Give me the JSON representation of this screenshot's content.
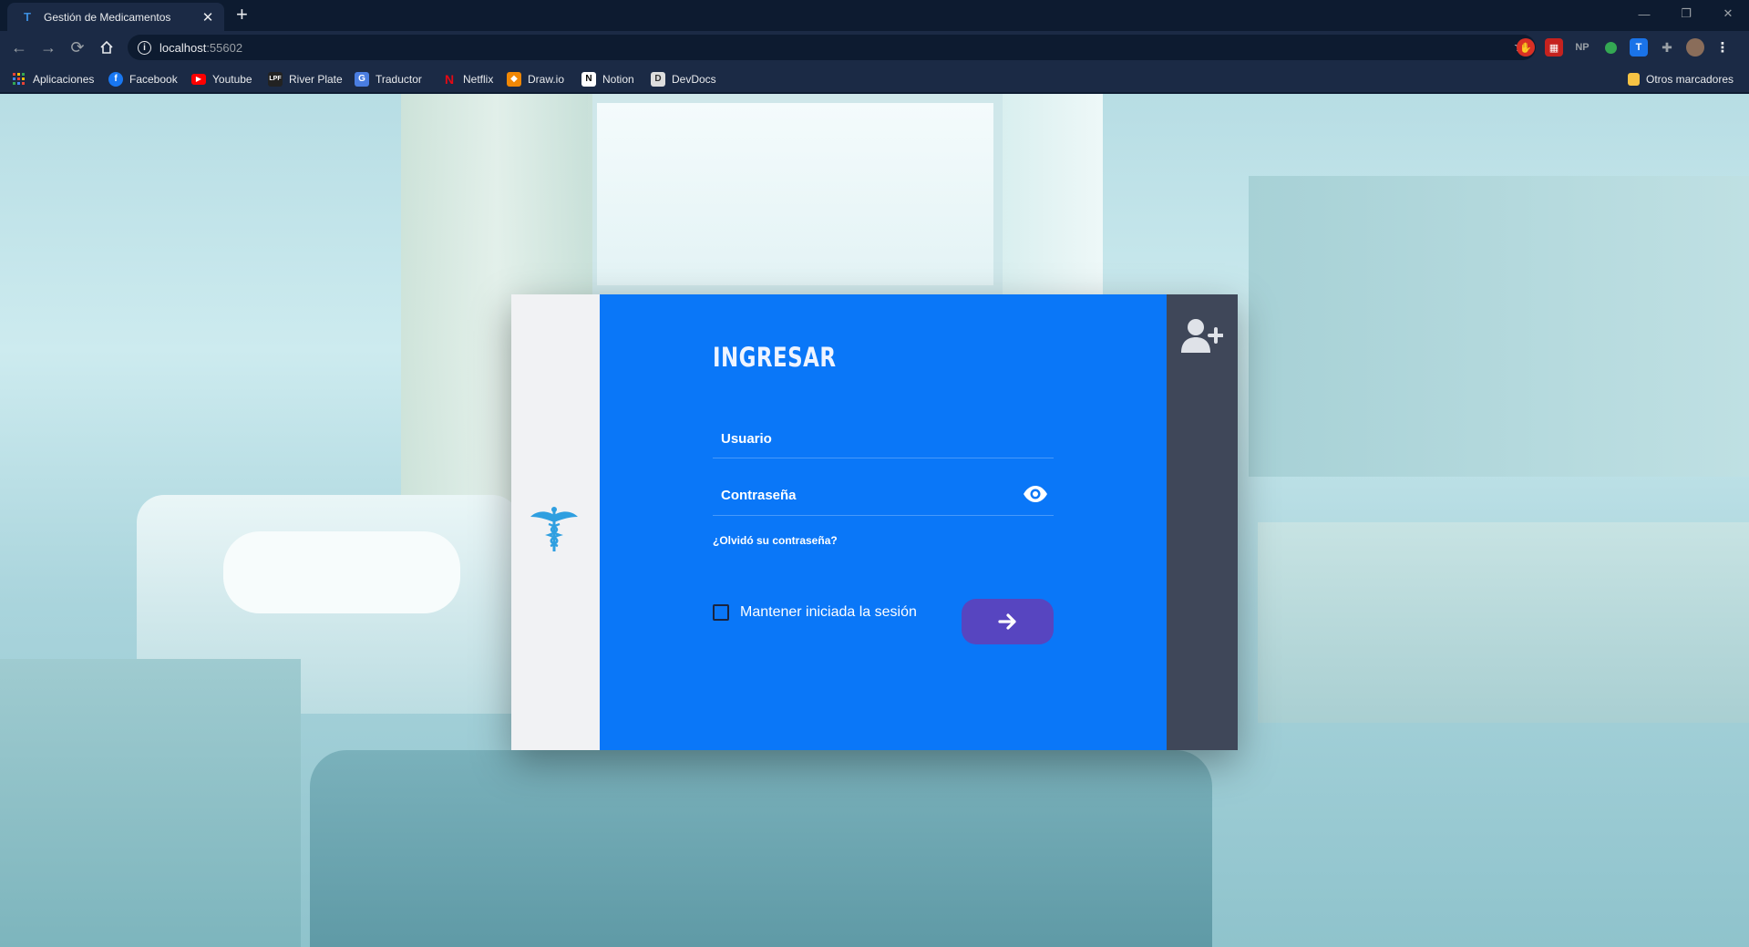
{
  "browser": {
    "tab_title": "Gestión de Medicamentos",
    "url_host": "localhost",
    "url_port": ":55602",
    "extensions": [
      "NP",
      "T"
    ],
    "bookmarks": [
      {
        "label": "Aplicaciones",
        "icon": "apps-grid-icon",
        "color": "#4285f4"
      },
      {
        "label": "Facebook",
        "icon": "facebook-icon",
        "color": "#1877f2"
      },
      {
        "label": "Youtube",
        "icon": "youtube-icon",
        "color": "#ff0000"
      },
      {
        "label": "River Plate",
        "icon": "river-plate-icon",
        "color": "#222222"
      },
      {
        "label": "Traductor",
        "icon": "translate-icon",
        "color": "#4a7de0"
      },
      {
        "label": "Netflix",
        "icon": "netflix-icon",
        "color": "#e50914"
      },
      {
        "label": "Draw.io",
        "icon": "drawio-icon",
        "color": "#f08705"
      },
      {
        "label": "Notion",
        "icon": "notion-icon",
        "color": "#ffffff"
      },
      {
        "label": "DevDocs",
        "icon": "devdocs-icon",
        "color": "#dddddd"
      }
    ],
    "other_bookmarks": "Otros marcadores"
  },
  "login": {
    "title": "INGRESAR",
    "username_placeholder": "Usuario",
    "password_placeholder": "Contraseña",
    "forgot_password": "¿Olvidó su contraseña?",
    "remember_me": "Mantener iniciada la sesión",
    "colors": {
      "form_bg": "#0a77f8",
      "brand_bg": "#f1f2f4",
      "side_bg": "#3f4759",
      "submit_bg": "#5745c0",
      "caduceus": "#2f9fe0"
    }
  }
}
